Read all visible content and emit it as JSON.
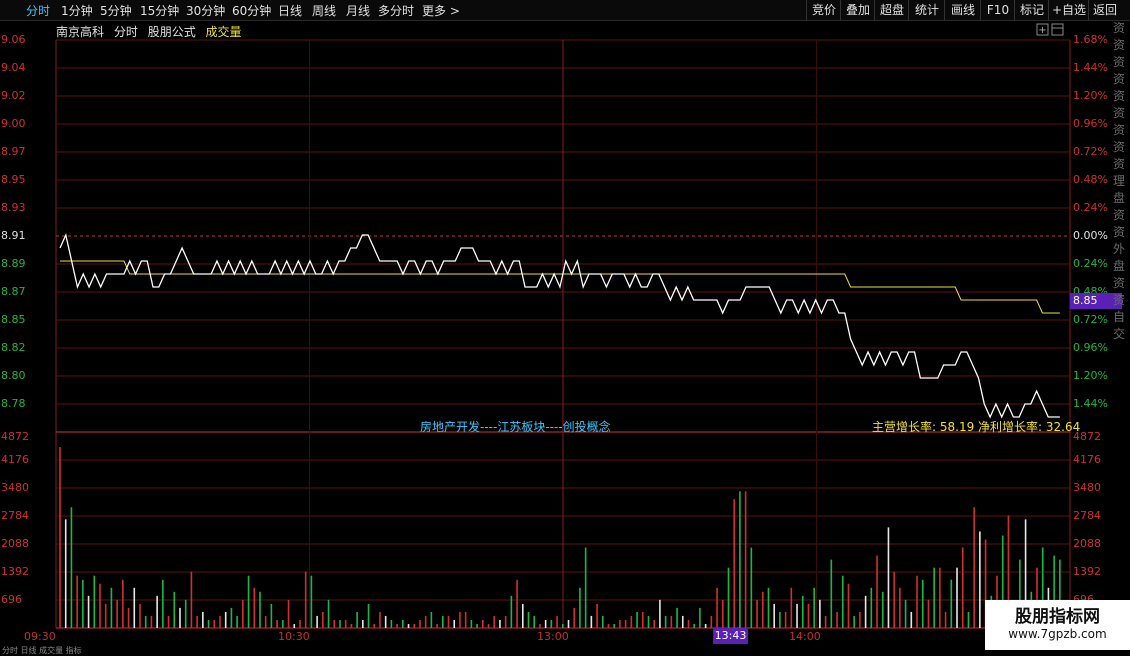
{
  "topbar": {
    "tabs": [
      "分时",
      "1分钟",
      "5分钟",
      "15分钟",
      "30分钟",
      "60分钟",
      "日线",
      "周线",
      "月线",
      "多分时",
      "更多 >"
    ],
    "active_tab": "分时",
    "right_buttons": [
      "竞价",
      "叠加",
      "超盘",
      "统计",
      "画线",
      "F10",
      "标记",
      "+自选",
      "返回"
    ]
  },
  "info": {
    "stock_name": "南京高科",
    "mode": "分时",
    "formula": "股朋公式",
    "indicator": "成交量"
  },
  "price_axis": {
    "left": [
      "9.06",
      "9.04",
      "9.02",
      "9.00",
      "8.97",
      "8.95",
      "8.93",
      "8.91",
      "8.89",
      "8.87",
      "8.85",
      "8.82",
      "8.80",
      "8.78"
    ],
    "right": [
      "1.68%",
      "1.44%",
      "1.20%",
      "0.96%",
      "0.72%",
      "0.48%",
      "0.24%",
      "0.00%",
      "0.24%",
      "0.48%",
      "0.72%",
      "0.96%",
      "1.20%",
      "1.44%"
    ],
    "current_price": "8.85"
  },
  "volume_axis": {
    "labels": [
      "4872",
      "4176",
      "3480",
      "2784",
      "2088",
      "1392",
      "696"
    ]
  },
  "time_axis": {
    "labels": [
      "09:30",
      "10:30",
      "13:00",
      "14:00"
    ],
    "cursor": "13:43"
  },
  "concept_text": "房地产开发----江苏板块----创投概念",
  "growth_text": "主营增长率: 58.19 净利增长率: 32.64",
  "right_stripe": "资资资资资资资资资理盘资资外盘资资自交",
  "watermark": {
    "title": "股朋指标网",
    "url": "www.7gpzb.com"
  },
  "bottom_text": "分时  日线  成交量  指标",
  "colors": {
    "up": "#d03030",
    "down": "#19b84a",
    "price_line": "#ffffff",
    "avg_line": "#f0e130",
    "cursor": "#5b21b6",
    "accent": "#36c8ff"
  },
  "chart_data": {
    "type": "line",
    "title": "",
    "prev_close": 8.91,
    "ylim": [
      8.77,
      9.06
    ],
    "price_series": [
      8.9,
      8.91,
      8.89,
      8.87,
      8.88,
      8.87,
      8.88,
      8.87,
      8.88,
      8.88,
      8.88,
      8.88,
      8.89,
      8.88,
      8.89,
      8.89,
      8.87,
      8.87,
      8.88,
      8.88,
      8.89,
      8.9,
      8.89,
      8.88,
      8.88,
      8.88,
      8.88,
      8.89,
      8.88,
      8.89,
      8.88,
      8.89,
      8.88,
      8.89,
      8.88,
      8.88,
      8.88,
      8.89,
      8.88,
      8.89,
      8.88,
      8.89,
      8.88,
      8.89,
      8.88,
      8.88,
      8.89,
      8.88,
      8.89,
      8.89,
      8.9,
      8.9,
      8.91,
      8.91,
      8.9,
      8.89,
      8.89,
      8.89,
      8.89,
      8.88,
      8.89,
      8.89,
      8.88,
      8.89,
      8.89,
      8.88,
      8.89,
      8.89,
      8.89,
      8.9,
      8.9,
      8.9,
      8.89,
      8.89,
      8.89,
      8.88,
      8.89,
      8.88,
      8.89,
      8.89,
      8.87,
      8.87,
      8.87,
      8.88,
      8.87,
      8.88,
      8.87,
      8.89,
      8.88,
      8.89,
      8.87,
      8.88,
      8.88,
      8.88,
      8.87,
      8.88,
      8.88,
      8.88,
      8.87,
      8.88,
      8.87,
      8.87,
      8.88,
      8.88,
      8.87,
      8.86,
      8.87,
      8.86,
      8.87,
      8.86,
      8.86,
      8.86,
      8.86,
      8.86,
      8.85,
      8.86,
      8.86,
      8.86,
      8.87,
      8.87,
      8.87,
      8.87,
      8.87,
      8.86,
      8.85,
      8.86,
      8.86,
      8.85,
      8.86,
      8.85,
      8.86,
      8.85,
      8.86,
      8.86,
      8.85,
      8.85,
      8.83,
      8.82,
      8.81,
      8.82,
      8.81,
      8.82,
      8.81,
      8.82,
      8.82,
      8.81,
      8.82,
      8.82,
      8.8,
      8.8,
      8.8,
      8.8,
      8.81,
      8.81,
      8.81,
      8.82,
      8.82,
      8.81,
      8.8,
      8.78,
      8.77,
      8.78,
      8.77,
      8.78,
      8.77,
      8.77,
      8.78,
      8.78,
      8.79,
      8.78,
      8.77,
      8.77,
      8.77
    ],
    "avg_series": [
      8.89,
      8.89,
      8.89,
      8.89,
      8.89,
      8.89,
      8.89,
      8.89,
      8.89,
      8.89,
      8.89,
      8.89,
      8.88,
      8.88,
      8.88,
      8.88,
      8.88,
      8.88,
      8.88,
      8.88,
      8.88,
      8.88,
      8.88,
      8.88,
      8.88,
      8.88,
      8.88,
      8.88,
      8.88,
      8.88,
      8.88,
      8.88,
      8.88,
      8.88,
      8.88,
      8.88,
      8.88,
      8.88,
      8.88,
      8.88,
      8.88,
      8.88,
      8.88,
      8.88,
      8.88,
      8.88,
      8.88,
      8.88,
      8.88,
      8.88,
      8.88,
      8.88,
      8.88,
      8.88,
      8.88,
      8.88,
      8.88,
      8.88,
      8.88,
      8.88,
      8.88,
      8.88,
      8.88,
      8.88,
      8.88,
      8.88,
      8.88,
      8.88,
      8.88,
      8.88,
      8.88,
      8.88,
      8.88,
      8.88,
      8.88,
      8.88,
      8.88,
      8.88,
      8.88,
      8.88,
      8.88,
      8.88,
      8.88,
      8.88,
      8.88,
      8.88,
      8.88,
      8.88,
      8.88,
      8.88,
      8.88,
      8.88,
      8.88,
      8.88,
      8.88,
      8.88,
      8.88,
      8.88,
      8.88,
      8.88,
      8.88,
      8.88,
      8.88,
      8.88,
      8.88,
      8.88,
      8.88,
      8.88,
      8.88,
      8.88,
      8.88,
      8.88,
      8.88,
      8.88,
      8.88,
      8.88,
      8.88,
      8.88,
      8.88,
      8.88,
      8.88,
      8.88,
      8.88,
      8.88,
      8.88,
      8.88,
      8.88,
      8.88,
      8.88,
      8.88,
      8.88,
      8.88,
      8.88,
      8.88,
      8.88,
      8.88,
      8.87,
      8.87,
      8.87,
      8.87,
      8.87,
      8.87,
      8.87,
      8.87,
      8.87,
      8.87,
      8.87,
      8.87,
      8.87,
      8.87,
      8.87,
      8.87,
      8.87,
      8.87,
      8.87,
      8.86,
      8.86,
      8.86,
      8.86,
      8.86,
      8.86,
      8.86,
      8.86,
      8.86,
      8.86,
      8.86,
      8.86,
      8.86,
      8.86,
      8.85,
      8.85,
      8.85,
      8.85
    ],
    "volume": [
      4500,
      2700,
      3000,
      1300,
      1200,
      800,
      1300,
      1100,
      600,
      1000,
      700,
      1200,
      500,
      1000,
      600,
      300,
      300,
      800,
      1200,
      300,
      900,
      500,
      700,
      1400,
      300,
      400,
      200,
      200,
      300,
      400,
      500,
      300,
      700,
      1300,
      1000,
      900,
      300,
      600,
      200,
      200,
      700,
      100,
      200,
      1400,
      1300,
      300,
      400,
      700,
      200,
      200,
      200,
      100,
      400,
      200,
      600,
      100,
      400,
      300,
      200,
      100,
      200,
      100,
      100,
      200,
      300,
      400,
      100,
      300,
      300,
      200,
      400,
      400,
      200,
      100,
      200,
      100,
      300,
      200,
      300,
      800,
      1200,
      600,
      400,
      300,
      100,
      200,
      200,
      300,
      100,
      200,
      500,
      1000,
      2000,
      300,
      600,
      300,
      100,
      100,
      200,
      200,
      300,
      400,
      400,
      300,
      200,
      700,
      300,
      300,
      500,
      300,
      200,
      100,
      500,
      100,
      300,
      1000,
      700,
      1500,
      3200,
      3400,
      3400,
      2000,
      700,
      900,
      1000,
      600,
      400,
      400,
      1000,
      600,
      800,
      600,
      1000,
      700,
      300,
      1700,
      400,
      1300,
      1100,
      300,
      400,
      800,
      1000,
      1800,
      900,
      2500,
      1400,
      1000,
      700,
      400,
      1300,
      1200,
      700,
      1500,
      1500,
      400,
      1200,
      1500,
      2000,
      400,
      3000,
      2400,
      2200,
      800,
      1300,
      2300,
      2800,
      500,
      1700,
      2700,
      900,
      1500,
      2000,
      1000,
      1800,
      1700
    ],
    "volume_colors": [
      "up",
      "up",
      "down",
      "up",
      "down",
      "up",
      "down",
      "up",
      "up",
      "down",
      "up",
      "up",
      "up",
      "up",
      "up",
      "down",
      "up",
      "up",
      "down",
      "up",
      "down",
      "up",
      "down",
      "up",
      "up",
      "up",
      "down",
      "up",
      "up",
      "up",
      "down",
      "down",
      "up",
      "down",
      "up",
      "down",
      "up",
      "down",
      "up",
      "down",
      "up",
      "up",
      "up",
      "up",
      "down",
      "up",
      "up",
      "down",
      "up",
      "down",
      "up",
      "up",
      "down",
      "up",
      "down",
      "up",
      "up",
      "up",
      "down",
      "up",
      "down",
      "up",
      "up",
      "up",
      "up",
      "down",
      "up",
      "down",
      "up",
      "up",
      "up",
      "up",
      "down",
      "down",
      "up",
      "up",
      "up",
      "up",
      "up",
      "down",
      "up",
      "up",
      "down",
      "down",
      "up",
      "up",
      "down",
      "up",
      "down",
      "up",
      "up",
      "down",
      "down",
      "up",
      "up",
      "down",
      "up",
      "down",
      "up",
      "up",
      "up",
      "down",
      "up",
      "down",
      "up",
      "up",
      "down",
      "up",
      "down",
      "up",
      "up",
      "down",
      "down",
      "up",
      "up",
      "up",
      "up",
      "down",
      "up",
      "down",
      "up",
      "down",
      "up",
      "up",
      "down",
      "up",
      "down",
      "up",
      "up",
      "up",
      "down",
      "up",
      "down",
      "up",
      "up",
      "down",
      "up",
      "down",
      "up",
      "down",
      "up",
      "up",
      "down",
      "up",
      "down",
      "up",
      "up",
      "up",
      "down",
      "up",
      "up",
      "down",
      "up",
      "down",
      "up",
      "up",
      "down",
      "up",
      "up",
      "down",
      "up",
      "up",
      "up",
      "down",
      "up",
      "down",
      "up",
      "up",
      "down",
      "up",
      "down",
      "up",
      "down",
      "up"
    ],
    "ylim_volume": [
      0,
      4872
    ]
  }
}
